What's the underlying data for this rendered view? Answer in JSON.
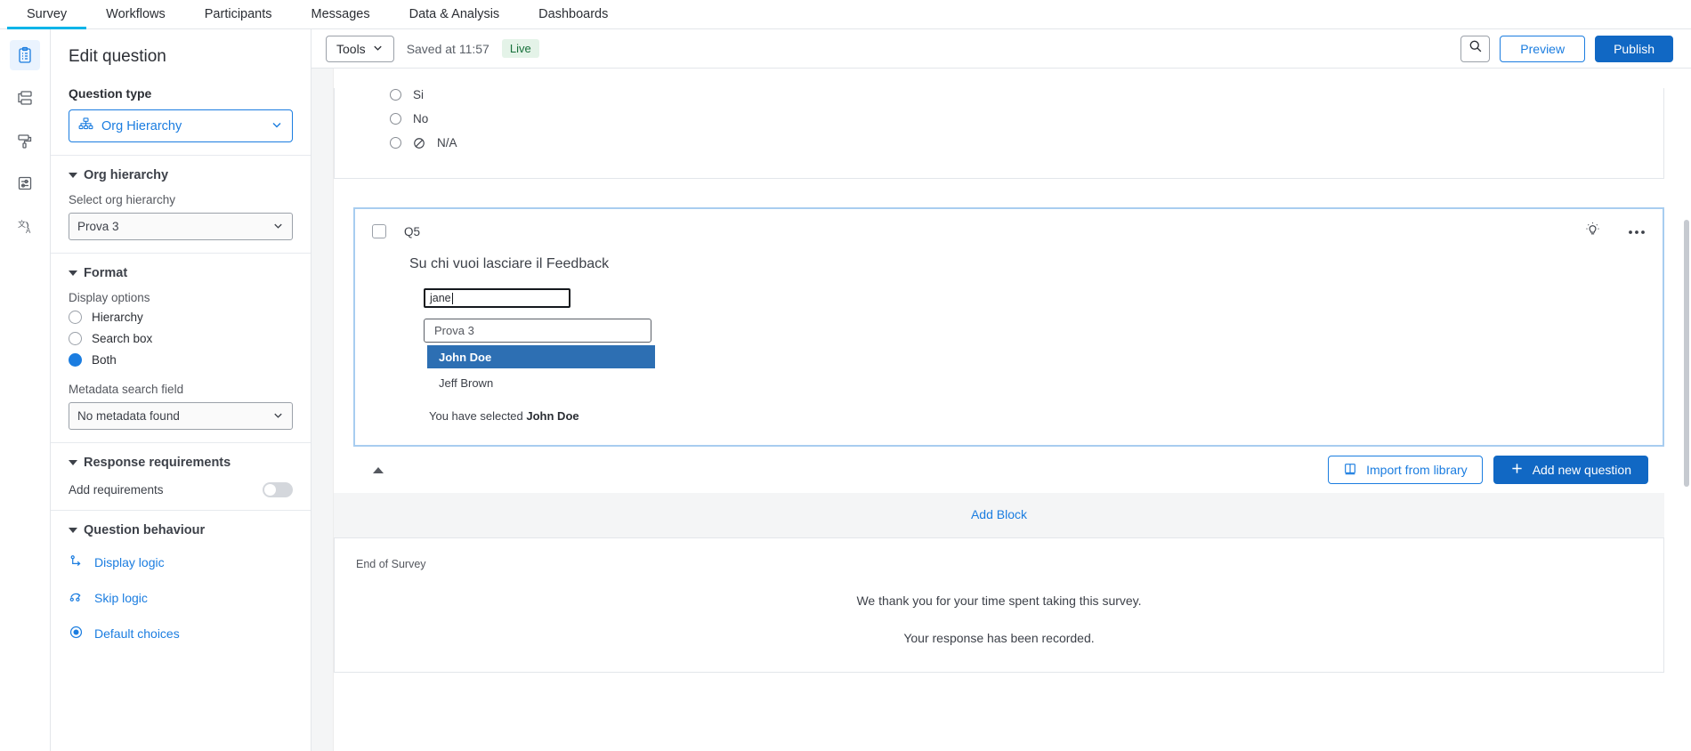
{
  "top_nav": {
    "items": [
      {
        "label": "Survey",
        "active": true
      },
      {
        "label": "Workflows",
        "active": false
      },
      {
        "label": "Participants",
        "active": false
      },
      {
        "label": "Messages",
        "active": false
      },
      {
        "label": "Data & Analysis",
        "active": false
      },
      {
        "label": "Dashboards",
        "active": false
      }
    ]
  },
  "icon_rail": {
    "items": [
      {
        "name": "survey-builder-icon",
        "active": true
      },
      {
        "name": "survey-flow-icon",
        "active": false
      },
      {
        "name": "look-and-feel-icon",
        "active": false
      },
      {
        "name": "survey-options-icon",
        "active": false
      },
      {
        "name": "translations-icon",
        "active": false
      }
    ]
  },
  "editor": {
    "title": "Edit question",
    "question_type": {
      "label": "Question type",
      "value": "Org Hierarchy"
    },
    "org_hierarchy": {
      "section_title": "Org hierarchy",
      "select_label": "Select org hierarchy",
      "select_value": "Prova 3"
    },
    "format": {
      "section_title": "Format",
      "display_options_label": "Display options",
      "options": [
        {
          "label": "Hierarchy",
          "selected": false
        },
        {
          "label": "Search box",
          "selected": false
        },
        {
          "label": "Both",
          "selected": true
        }
      ],
      "metadata_label": "Metadata search field",
      "metadata_value": "No metadata found"
    },
    "response_requirements": {
      "section_title": "Response requirements",
      "add_requirements_label": "Add requirements",
      "add_requirements_on": false
    },
    "question_behaviour": {
      "section_title": "Question behaviour",
      "links": [
        {
          "label": "Display logic",
          "icon": "display-logic-icon"
        },
        {
          "label": "Skip logic",
          "icon": "skip-logic-icon"
        },
        {
          "label": "Default choices",
          "icon": "default-choices-icon"
        }
      ]
    }
  },
  "toolbar": {
    "tools_label": "Tools",
    "saved_text": "Saved at 11:57",
    "live_badge": "Live",
    "preview_label": "Preview",
    "publish_label": "Publish"
  },
  "canvas": {
    "previous_question": {
      "options": [
        {
          "label": "Si",
          "has_na_icon": false
        },
        {
          "label": "No",
          "has_na_icon": false
        },
        {
          "label": "N/A",
          "has_na_icon": true
        }
      ]
    },
    "question": {
      "id": "Q5",
      "title": "Su chi vuoi lasciare il Feedback",
      "search_value": "jane",
      "hierarchy_value": "Prova 3",
      "results": [
        {
          "label": "John Doe",
          "selected": true
        },
        {
          "label": "Jeff Brown",
          "selected": false
        }
      ],
      "selection_prefix": "You have selected ",
      "selection_name": "John Doe"
    },
    "block_footer": {
      "import_label": "Import from library",
      "add_question_label": "Add new question"
    },
    "add_block_label": "Add Block",
    "end_of_survey": {
      "label": "End of Survey",
      "line1": "We thank you for your time spent taking this survey.",
      "line2": "Your response has been recorded."
    }
  },
  "colors": {
    "accent_blue": "#1b7de0",
    "publish_blue": "#1168c4",
    "highlight_blue": "#2d6fb3",
    "live_green_bg": "#e4f3e8",
    "live_green_text": "#17703a",
    "nav_underline": "#00b4e8"
  }
}
